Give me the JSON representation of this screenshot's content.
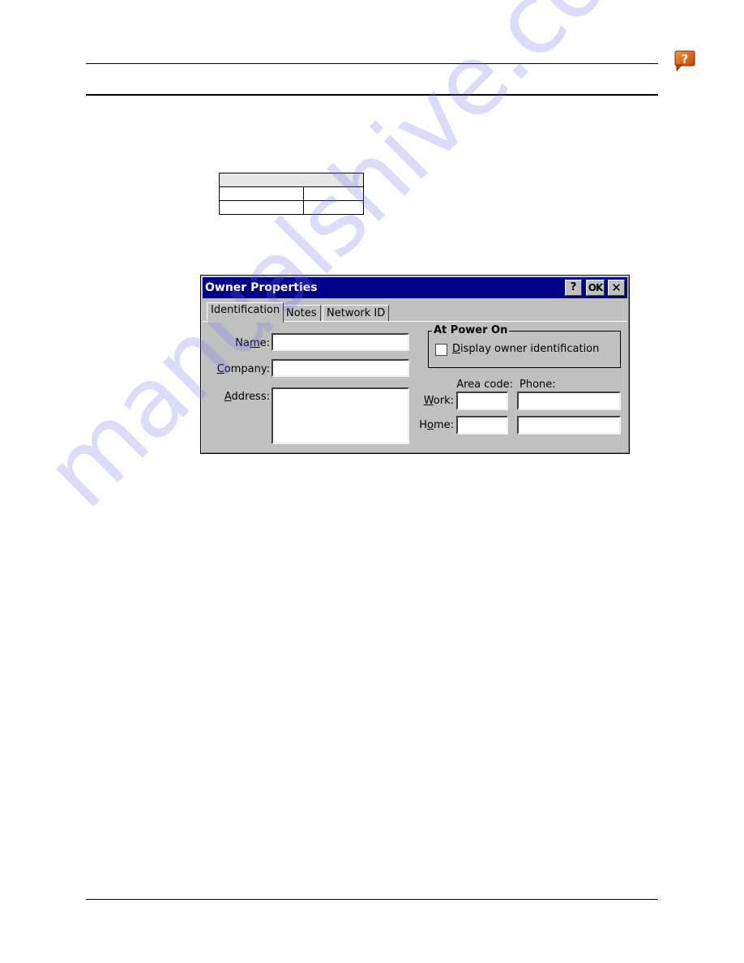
{
  "page": {
    "help_icon": "help-speech-bubble-icon",
    "help_icon_color": "#e0661a",
    "watermark": "manualshive.com"
  },
  "table": {
    "header": "",
    "rows": [
      [
        "",
        ""
      ],
      [
        "",
        ""
      ]
    ]
  },
  "dialog": {
    "title": "Owner Properties",
    "title_bar_color": "#00008b",
    "buttons": {
      "help": "?",
      "ok": "OK",
      "close": "✕"
    },
    "tabs": [
      {
        "label": "Identification",
        "active": true
      },
      {
        "label": "Notes",
        "active": false
      },
      {
        "label": "Network ID",
        "active": false
      }
    ],
    "fields": {
      "name": {
        "label": "Name:",
        "value": ""
      },
      "company": {
        "label": "Company:",
        "value": ""
      },
      "address": {
        "label": "Address:",
        "value": ""
      }
    },
    "at_power_on": {
      "group_label": "At Power On",
      "checkbox_label": "Display owner identification",
      "checked": false
    },
    "phone": {
      "area_code_header": "Area code:",
      "phone_header": "Phone:",
      "work": {
        "label": "Work:",
        "area_code": "",
        "phone": ""
      },
      "home": {
        "label": "Home:",
        "area_code": "",
        "phone": ""
      }
    }
  }
}
